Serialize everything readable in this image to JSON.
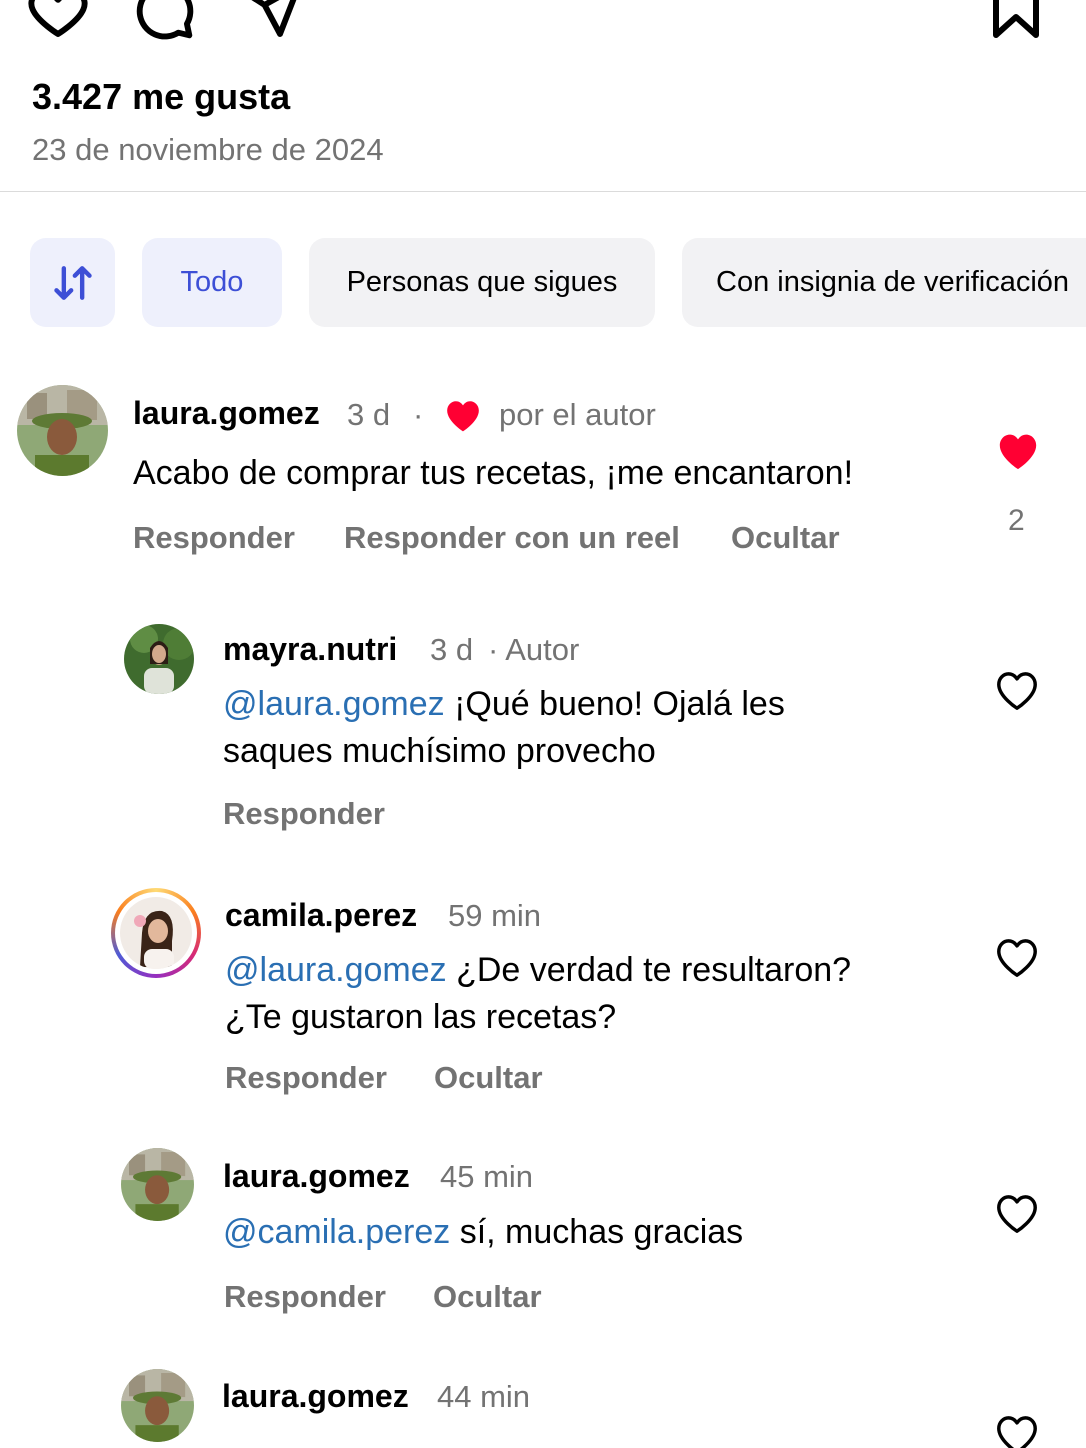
{
  "post": {
    "likes": "3.427 me gusta",
    "date": "23 de noviembre de 2024"
  },
  "filters": {
    "sort_icon": "sort-arrows-icon",
    "items": [
      {
        "label": "Todo",
        "active": true
      },
      {
        "label": "Personas que sigues",
        "active": false
      },
      {
        "label": "Con insignia de verificación",
        "active": false
      }
    ]
  },
  "colors": {
    "accent": "#3d4fd6",
    "mention": "#2a6fb3",
    "heart_red": "#ff0033",
    "secondary_text": "#737373"
  },
  "comments": [
    {
      "username": "laura.gomez",
      "time": "3 d",
      "separator": "·",
      "author_like_label": "por el autor",
      "text": "Acabo de comprar tus recetas, ¡me encantaron!",
      "actions": [
        "Responder",
        "Responder con un reel",
        "Ocultar"
      ],
      "liked": true,
      "like_count": "2"
    }
  ],
  "replies": [
    {
      "username": "mayra.nutri",
      "time": "3 d",
      "badge": "· Autor",
      "mention": "@laura.gomez",
      "text_line1": " ¡Qué bueno! Ojalá les",
      "text_line2": "saques muchísimo provecho",
      "actions": [
        "Responder"
      ]
    },
    {
      "username": "camila.perez",
      "time": "59 min",
      "mention": "@laura.gomez",
      "text_line1": " ¿De verdad te resultaron?",
      "text_line2": "¿Te gustaron las recetas?",
      "actions": [
        "Responder",
        "Ocultar"
      ]
    },
    {
      "username": "laura.gomez",
      "time": "45 min",
      "mention": "@camila.perez",
      "text_line1": " sí, muchas gracias",
      "actions": [
        "Responder",
        "Ocultar"
      ]
    },
    {
      "username": "laura.gomez",
      "time": "44 min"
    }
  ]
}
